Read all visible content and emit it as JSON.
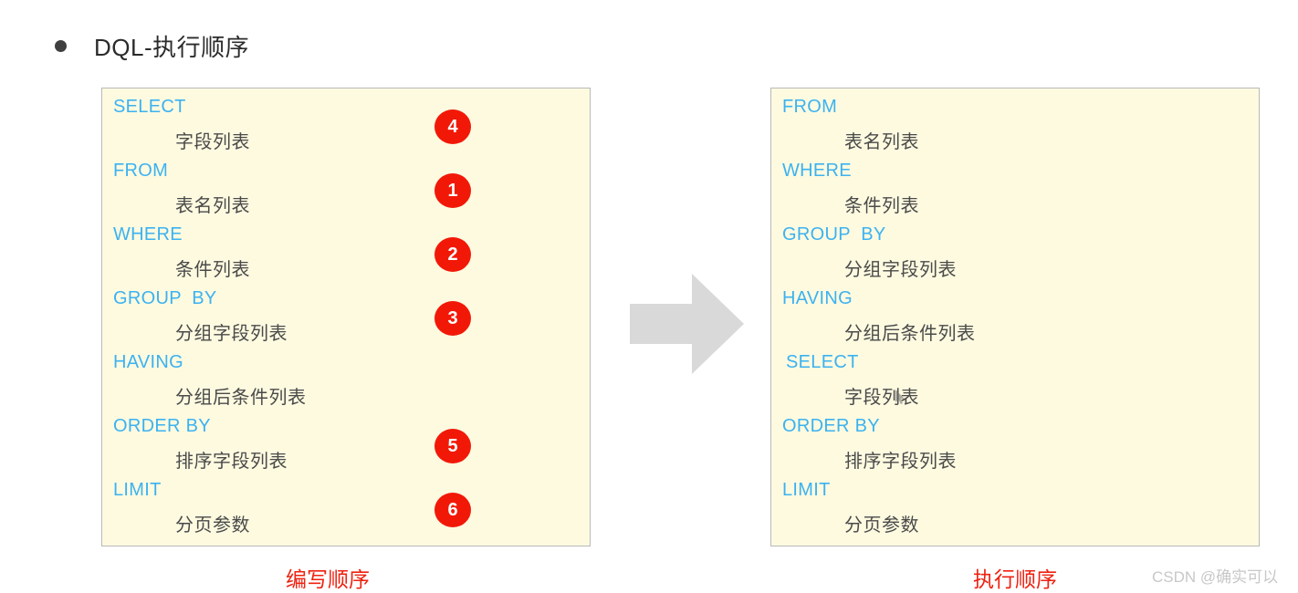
{
  "slide": {
    "title": "DQL-执行顺序",
    "bullet_icon": "bullet-dot-icon"
  },
  "write_order_panel": {
    "caption": "编写顺序",
    "clauses": [
      {
        "keyword": "SELECT",
        "value": "字段列表",
        "step": "4"
      },
      {
        "keyword": "FROM",
        "value": "表名列表",
        "step": "1"
      },
      {
        "keyword": "WHERE",
        "value": "条件列表",
        "step": "2"
      },
      {
        "keyword": "GROUP  BY",
        "value": "分组字段列表",
        "step": "3"
      },
      {
        "keyword": "HAVING",
        "value": "分组后条件列表",
        "step": ""
      },
      {
        "keyword": "ORDER BY",
        "value": "排序字段列表",
        "step": "5"
      },
      {
        "keyword": "LIMIT",
        "value": "分页参数",
        "step": "6"
      }
    ]
  },
  "exec_order_panel": {
    "caption": "执行顺序",
    "clauses": [
      {
        "keyword": "FROM",
        "value": "表名列表"
      },
      {
        "keyword": "WHERE",
        "value": "条件列表"
      },
      {
        "keyword": "GROUP  BY",
        "value": "分组字段列表"
      },
      {
        "keyword": "HAVING",
        "value": "分组后条件列表"
      },
      {
        "keyword": "SELECT",
        "value": "字段列表"
      },
      {
        "keyword": "ORDER BY",
        "value": "排序字段列表"
      },
      {
        "keyword": "LIMIT",
        "value": "分页参数"
      }
    ]
  },
  "arrow": {
    "icon": "right-block-arrow-icon"
  },
  "watermark": {
    "text": "CSDN @确实可以"
  },
  "colors": {
    "panel_background": "#fdfae0",
    "panel_border": "#b9b9b9",
    "keyword": "#3cb2f0",
    "value_text": "#4a4a4a",
    "badge_background": "#f21807",
    "badge_text": "#ffffff",
    "caption": "#ee2211",
    "arrow": "#d9d9d9",
    "title_text": "#2b2b2b",
    "watermark": "#c8c8c8"
  }
}
